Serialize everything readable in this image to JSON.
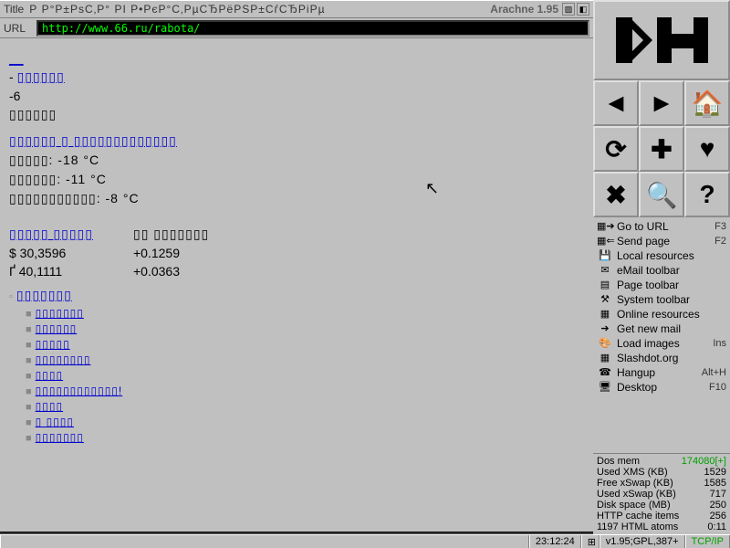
{
  "title": {
    "label": "Title",
    "text": "Р Р°Р±РѕС‚Р° РІ Р•РєР°С‚РµСЂРёРЅР±СѓСЂРіРµ",
    "brand": "Arachne 1.95"
  },
  "url": {
    "label": "URL",
    "value": "http://www.66.ru/rabota/"
  },
  "content": {
    "link_top": "__",
    "bullet1_prefix": "- ",
    "bullet1_link": "▯▯▯▯▯▯",
    "l2": "-6",
    "l3": "▯▯▯▯▯▯",
    "link_long": "▯▯▯▯▯▯ ▯ ▯▯▯▯▯▯▯▯▯▯▯▯▯",
    "wx1": "▯▯▯▯▯: -18 °C",
    "wx2": "▯▯▯▯▯▯: -11 °C",
    "wx3": "▯▯▯▯▯▯▯▯▯▯▯: -8 °C",
    "tab_link": "▯▯▯▯▯ ▯▯▯▯▯",
    "tab_text": "▯▯ ▯▯▯▯▯▯▯",
    "row1a": "$ 30,3596",
    "row1b": "+0.1259",
    "row2a": "Ґ 40,1111",
    "row2b": "+0.0363",
    "list_head": "▯▯▯▯▯▯▯",
    "items": [
      "▯▯▯▯▯▯▯",
      "▯▯▯▯▯▯",
      "▯▯▯▯▯",
      "▯▯▯▯▯▯▯▯",
      "▯▯▯▯",
      "▯▯▯▯▯▯▯▯▯▯▯▯!",
      "▯▯▯▯",
      "▯ ▯▯▯▯",
      "▯▯▯▯▯▯▯"
    ]
  },
  "menu": [
    {
      "icon": "▦➔",
      "label": "Go to URL",
      "key": "F3"
    },
    {
      "icon": "▦⇐",
      "label": "Send page",
      "key": "F2"
    },
    {
      "icon": "💾",
      "label": "Local resources",
      "key": ""
    },
    {
      "icon": "✉",
      "label": "eMail toolbar",
      "key": ""
    },
    {
      "icon": "▤",
      "label": "Page toolbar",
      "key": ""
    },
    {
      "icon": "⚒",
      "label": "System toolbar",
      "key": ""
    },
    {
      "icon": "▦",
      "label": "Online resources",
      "key": ""
    },
    {
      "icon": "➔",
      "label": "Get new mail",
      "key": ""
    },
    {
      "icon": "🎨",
      "label": "Load images",
      "key": "Ins"
    },
    {
      "icon": "▦",
      "label": "Slashdot.org",
      "key": ""
    },
    {
      "icon": "☎",
      "label": "Hangup",
      "key": "Alt+H"
    },
    {
      "icon": "🖥",
      "label": "Desktop",
      "key": "F10"
    }
  ],
  "stats": [
    {
      "label": "Dos mem",
      "value": "174080[+]",
      "green": true
    },
    {
      "label": "Used XMS (KB)",
      "value": "1529"
    },
    {
      "label": "Free xSwap (KB)",
      "value": "1585"
    },
    {
      "label": "Used xSwap (KB)",
      "value": "717"
    },
    {
      "label": "Disk space (MB)",
      "value": "250"
    },
    {
      "label": "HTTP cache items",
      "value": "256"
    },
    {
      "label": "1197 HTML atoms",
      "value": "0:11"
    }
  ],
  "status": {
    "time": "23:12:24",
    "ver": "v1.95;GPL,387+",
    "net": "TCP/IP"
  },
  "nav_icons": [
    "◄",
    "►",
    "🏠",
    "⟳",
    "✚",
    "♥",
    "✖",
    "🔍",
    "?"
  ]
}
